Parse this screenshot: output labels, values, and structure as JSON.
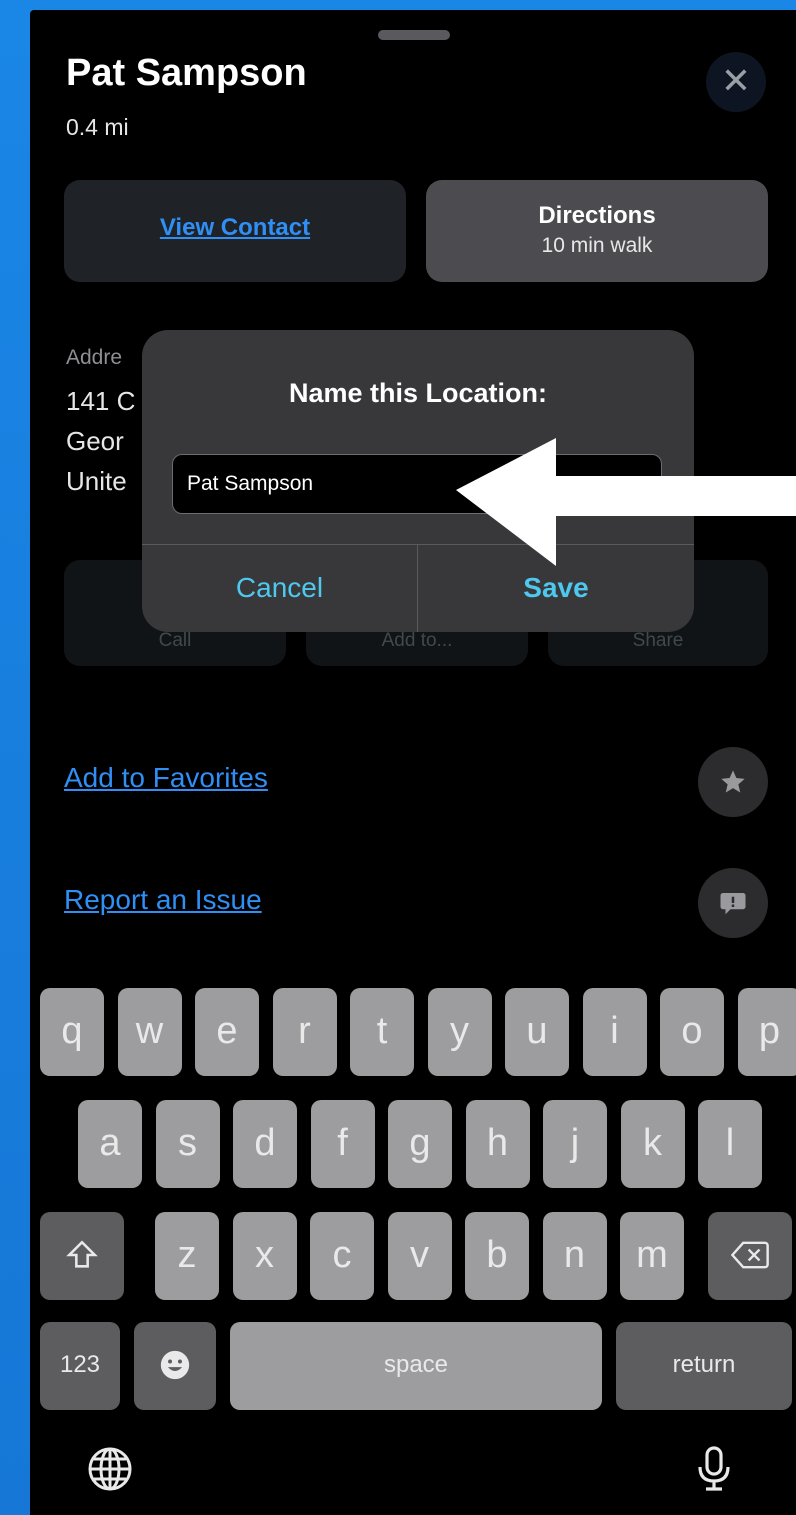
{
  "place": {
    "name": "Pat Sampson",
    "distance": "0.4 mi"
  },
  "buttons": {
    "view_contact": "View Contact",
    "directions_title": "Directions",
    "directions_subtitle": "10 min walk",
    "close_glyph": "✕"
  },
  "address": {
    "label": "Addre",
    "lines": [
      "141 C",
      "Geor",
      "Unite"
    ]
  },
  "actions": [
    "Call",
    "Add to...",
    "Share"
  ],
  "links": {
    "favorites": "Add to Favorites",
    "report": "Report an Issue"
  },
  "dialog": {
    "title": "Name this Location:",
    "field_value": "Pat Sampson",
    "cancel": "Cancel",
    "save": "Save"
  },
  "keyboard": {
    "row1": [
      "q",
      "w",
      "e",
      "r",
      "t",
      "y",
      "u",
      "i",
      "o",
      "p"
    ],
    "row2": [
      "a",
      "s",
      "d",
      "f",
      "g",
      "h",
      "j",
      "k",
      "l"
    ],
    "row3": [
      "z",
      "x",
      "c",
      "v",
      "b",
      "n",
      "m"
    ],
    "numbers": "123",
    "space": "space",
    "return": "return"
  },
  "icons": {
    "close": "close-icon",
    "star": "star-icon",
    "report": "exclamation-bubble-icon",
    "shift": "shift-icon",
    "backspace": "backspace-icon",
    "emoji": "emoji-icon",
    "globe": "globe-icon",
    "mic": "microphone-icon"
  },
  "colors": {
    "link_blue": "#2f8ff5",
    "dialog_button": "#4ec8ee",
    "key_light": "#9d9d9f",
    "key_dark": "#5d5d60",
    "frame_blue": "#1a86e6"
  }
}
